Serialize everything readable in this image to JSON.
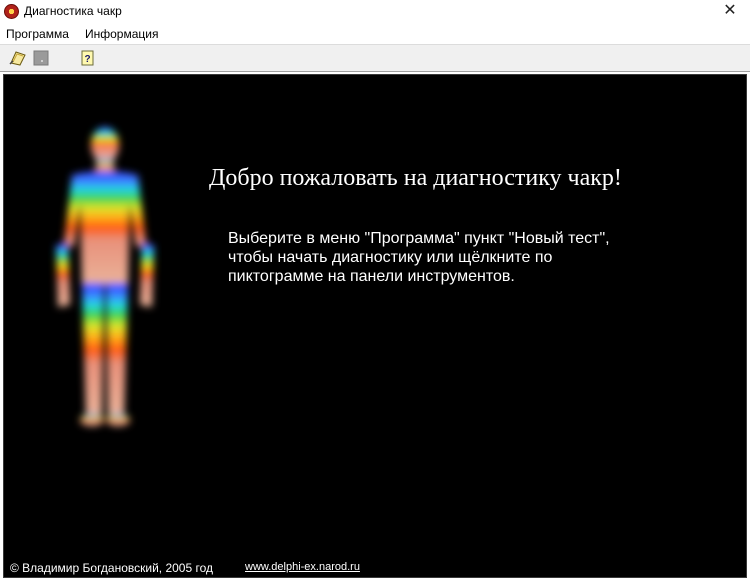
{
  "window": {
    "title": "Диагностика чакр",
    "close_symbol": "✕"
  },
  "menu": {
    "program": "Программа",
    "info": "Информация"
  },
  "toolbar": {
    "buttons": [
      "new-test-icon",
      "stop-icon",
      "help-icon"
    ]
  },
  "content": {
    "welcome": "Добро пожаловать на диагностику чакр!",
    "instructions": [
      "Выберите в меню \"Программа\" пункт \"Новый тест\",",
      "чтобы начать диагностику или щёлкните по",
      "пиктограмме на панели инструментов."
    ],
    "copyright": "© Владимир Богдановский, 2005 год",
    "site": "www.delphi-ex.narod.ru"
  },
  "colors": {
    "background": "#000000",
    "text": "#ffffff"
  }
}
